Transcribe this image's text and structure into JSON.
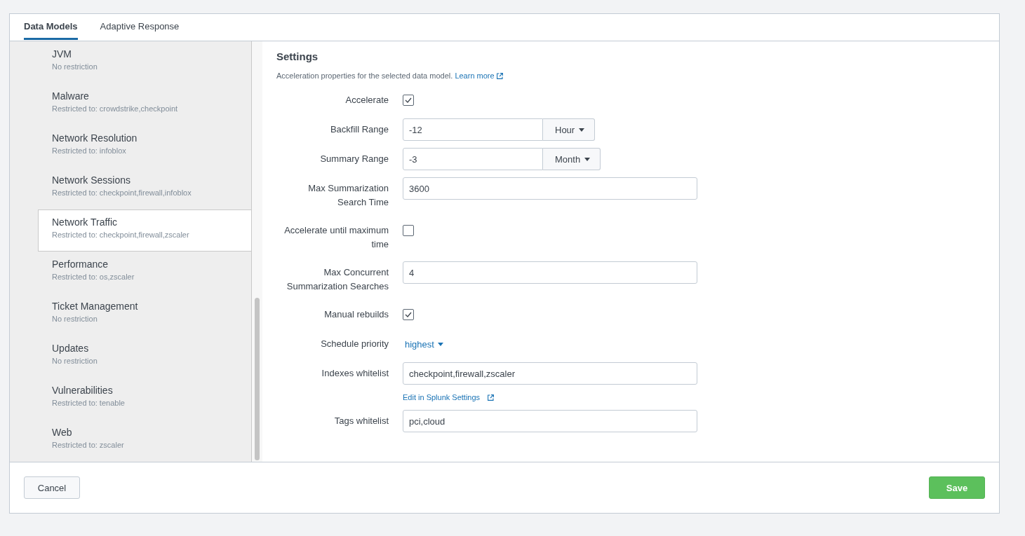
{
  "tabs": [
    {
      "label": "Data Models",
      "selected": true
    },
    {
      "label": "Adaptive Response",
      "selected": false
    }
  ],
  "data_models": [
    {
      "name": "JVM",
      "restriction": "No restriction",
      "selected": false
    },
    {
      "name": "Malware",
      "restriction": "Restricted to: crowdstrike,checkpoint",
      "selected": false
    },
    {
      "name": "Network Resolution",
      "restriction": "Restricted to: infoblox",
      "selected": false
    },
    {
      "name": "Network Sessions",
      "restriction": "Restricted to: checkpoint,firewall,infoblox",
      "selected": false
    },
    {
      "name": "Network Traffic",
      "restriction": "Restricted to: checkpoint,firewall,zscaler",
      "selected": true
    },
    {
      "name": "Performance",
      "restriction": "Restricted to: os,zscaler",
      "selected": false
    },
    {
      "name": "Ticket Management",
      "restriction": "No restriction",
      "selected": false
    },
    {
      "name": "Updates",
      "restriction": "No restriction",
      "selected": false
    },
    {
      "name": "Vulnerabilities",
      "restriction": "Restricted to: tenable",
      "selected": false
    },
    {
      "name": "Web",
      "restriction": "Restricted to: zscaler",
      "selected": false
    }
  ],
  "settings": {
    "title": "Settings",
    "description": "Acceleration properties for the selected data model.",
    "learn_more": "Learn more",
    "fields": [
      {
        "kind": "checkbox",
        "label": "Accelerate",
        "checked": true
      },
      {
        "kind": "range",
        "label": "Backfill Range",
        "value": "-12",
        "unit": "Hour"
      },
      {
        "kind": "range",
        "label": "Summary Range",
        "value": "-3",
        "unit": "Month"
      },
      {
        "kind": "text",
        "label": "Max Summarization Search Time",
        "value": "3600"
      },
      {
        "kind": "checkbox",
        "label": "Accelerate until maximum time",
        "checked": false
      },
      {
        "kind": "text",
        "label": "Max Concurrent Summarization Searches",
        "value": "4"
      },
      {
        "kind": "checkbox",
        "label": "Manual rebuilds",
        "checked": true
      },
      {
        "kind": "menu",
        "label": "Schedule priority",
        "value": "highest"
      },
      {
        "kind": "text",
        "label": "Indexes whitelist",
        "value": "checkpoint,firewall,zscaler",
        "help_link": "Edit in Splunk Settings"
      },
      {
        "kind": "text",
        "label": "Tags whitelist",
        "value": "pci,cloud"
      }
    ]
  },
  "footer": {
    "cancel": "Cancel",
    "save": "Save"
  }
}
